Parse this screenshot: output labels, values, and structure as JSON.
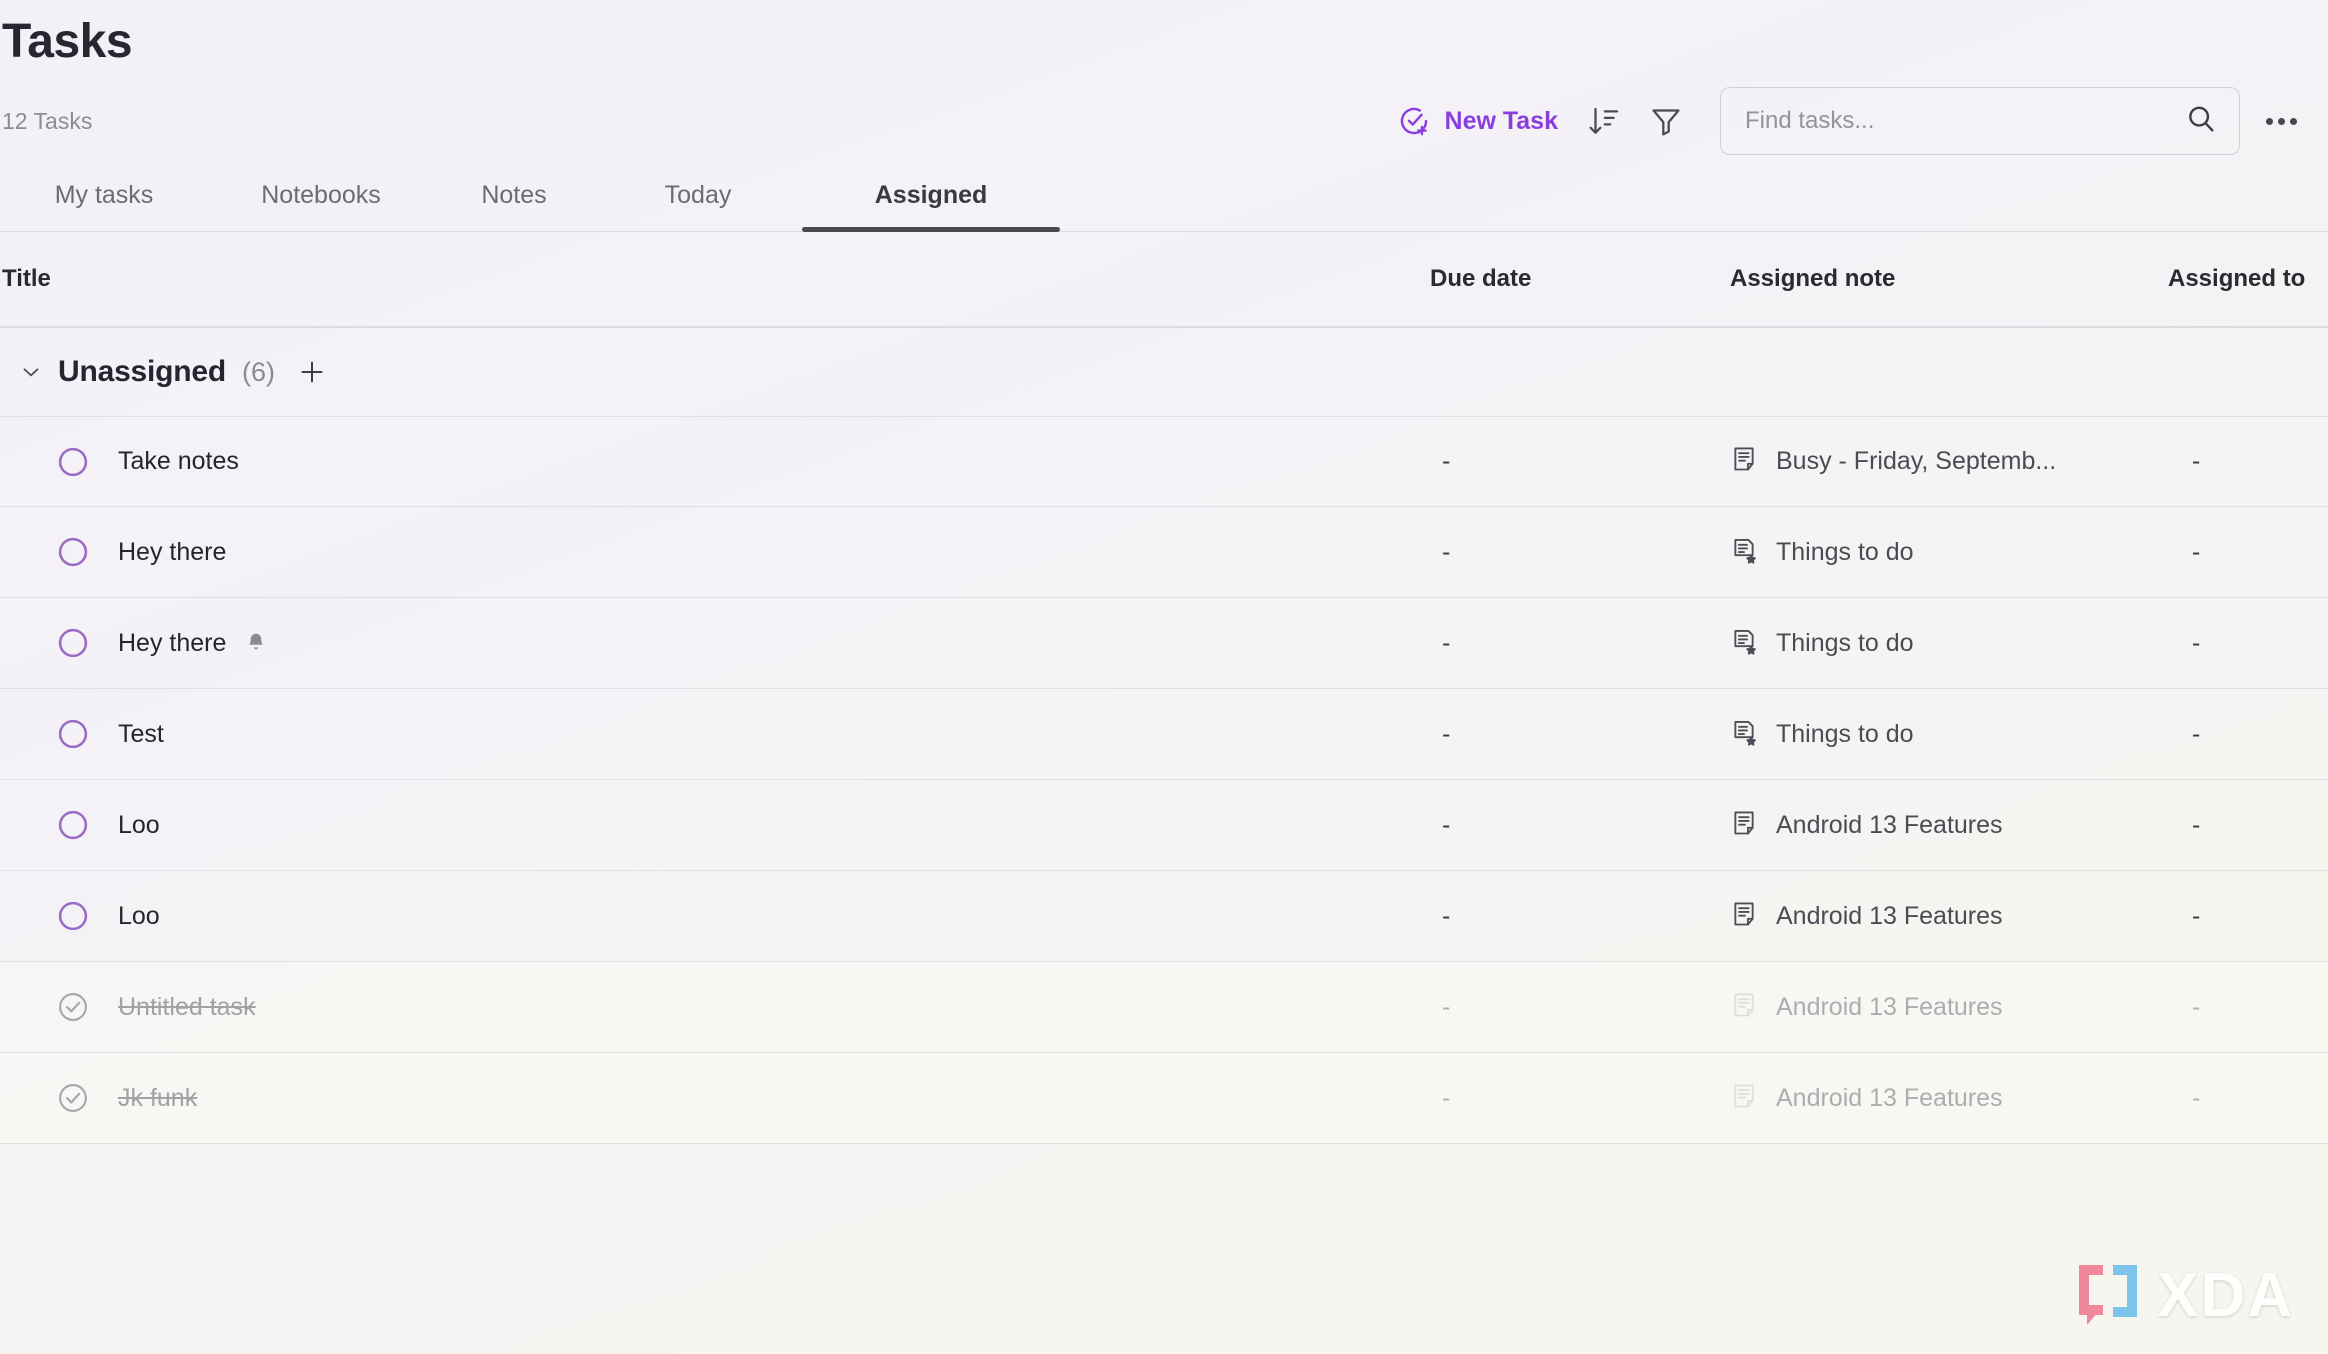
{
  "header": {
    "title": "Tasks",
    "task_count": "12 Tasks"
  },
  "toolbar": {
    "new_task_label": "New Task",
    "new_task_icon": "check-circle-plus-icon",
    "sort_icon": "sort-descending-icon",
    "filter_icon": "filter-funnel-icon",
    "more_icon": "more-horizontal-icon",
    "accent_color": "#8b3ee0"
  },
  "search": {
    "placeholder": "Find tasks...",
    "value": "",
    "icon": "search-icon"
  },
  "tabs": [
    {
      "label": "My tasks",
      "active": false
    },
    {
      "label": "Notebooks",
      "active": false
    },
    {
      "label": "Notes",
      "active": false
    },
    {
      "label": "Today",
      "active": false
    },
    {
      "label": "Assigned",
      "active": true
    }
  ],
  "table": {
    "columns": {
      "title": "Title",
      "due_date": "Due date",
      "assigned_note": "Assigned note",
      "assigned_to": "Assigned to"
    }
  },
  "group": {
    "name": "Unassigned",
    "count": "(6)",
    "chevron_icon": "chevron-down-icon",
    "add_icon": "plus-icon"
  },
  "rows": [
    {
      "title": "Take notes",
      "due_date": "-",
      "assigned_note": "Busy - Friday, Septemb...",
      "note_icon": "note-icon",
      "assigned_to": "-",
      "done": false,
      "reminder": false
    },
    {
      "title": "Hey there",
      "due_date": "-",
      "assigned_note": "Things to do",
      "note_icon": "note-star-icon",
      "assigned_to": "-",
      "done": false,
      "reminder": false
    },
    {
      "title": "Hey there",
      "due_date": "-",
      "assigned_note": "Things to do",
      "note_icon": "note-star-icon",
      "assigned_to": "-",
      "done": false,
      "reminder": true
    },
    {
      "title": "Test",
      "due_date": "-",
      "assigned_note": "Things to do",
      "note_icon": "note-star-icon",
      "assigned_to": "-",
      "done": false,
      "reminder": false
    },
    {
      "title": "Loo",
      "due_date": "-",
      "assigned_note": "Android 13 Features",
      "note_icon": "note-icon",
      "assigned_to": "-",
      "done": false,
      "reminder": false
    },
    {
      "title": "Loo",
      "due_date": "-",
      "assigned_note": "Android 13 Features",
      "note_icon": "note-icon",
      "assigned_to": "-",
      "done": false,
      "reminder": false
    },
    {
      "title": "Untitled task",
      "due_date": "-",
      "assigned_note": "Android 13 Features",
      "note_icon": "note-icon",
      "assigned_to": "-",
      "done": true,
      "reminder": false
    },
    {
      "title": "Jk funk",
      "due_date": "-",
      "assigned_note": "Android 13 Features",
      "note_icon": "note-icon",
      "assigned_to": "-",
      "done": true,
      "reminder": false
    }
  ],
  "watermark": {
    "text": "XDA",
    "bracket_left_color": "#f07f96",
    "bracket_right_color": "#73c0ea"
  }
}
